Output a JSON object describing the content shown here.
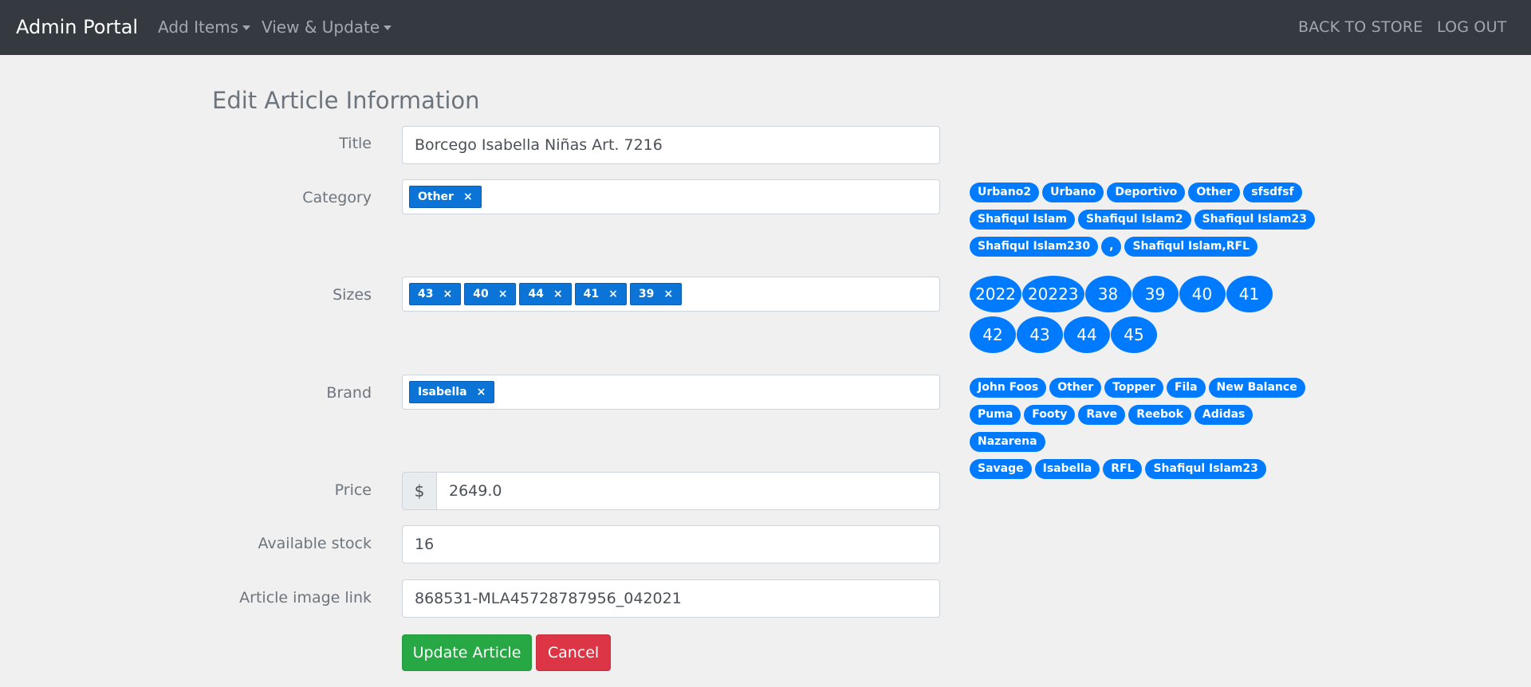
{
  "navbar": {
    "brand": "Admin Portal",
    "menus": [
      "Add Items",
      "View & Update"
    ],
    "back_to_store": "BACK TO STORE",
    "log_out": "LOG OUT"
  },
  "form": {
    "heading": "Edit Article Information",
    "title_label": "Title",
    "title_value": "Borcego Isabella Niñas Art. 7216",
    "category_label": "Category",
    "category_selected": [
      "Other"
    ],
    "sizes_label": "Sizes",
    "sizes_selected": [
      "43",
      "40",
      "44",
      "41",
      "39"
    ],
    "brand_label": "Brand",
    "brand_selected": [
      "Isabella"
    ],
    "price_label": "Price",
    "price_prefix": "$",
    "price_value": "2649.0",
    "stock_label": "Available stock",
    "stock_value": "16",
    "image_label": "Article image link",
    "image_value": "868531-MLA45728787956_042021",
    "update_button": "Update Article",
    "cancel_button": "Cancel",
    "remove_glyph": "×"
  },
  "suggestions": {
    "categories": [
      "Urbano2",
      "Urbano",
      "Deportivo",
      "Other",
      "sfsdfsf",
      "Shafiqul Islam",
      "Shafiqul Islam2",
      "Shafiqul Islam23",
      "Shafiqul Islam230",
      ",",
      "Shafiqul Islam,RFL"
    ],
    "sizes": [
      "2022",
      "20223",
      "38",
      "39",
      "40",
      "41",
      "42",
      "43",
      "44",
      "45"
    ],
    "brands": [
      "John Foos",
      "Other",
      "Topper",
      "Fila",
      "New Balance",
      "Puma",
      "Footy",
      "Rave",
      "Reebok",
      "Adidas",
      "Nazarena",
      "Savage",
      "Isabella",
      "RFL",
      "Shafiqul Islam23"
    ]
  },
  "colors": {
    "navbar_bg": "#343a40",
    "page_bg": "#f0f0f0",
    "chip_blue": "#0b74d6",
    "pill_blue": "#007bff",
    "success": "#28a745",
    "danger": "#dc3545"
  }
}
